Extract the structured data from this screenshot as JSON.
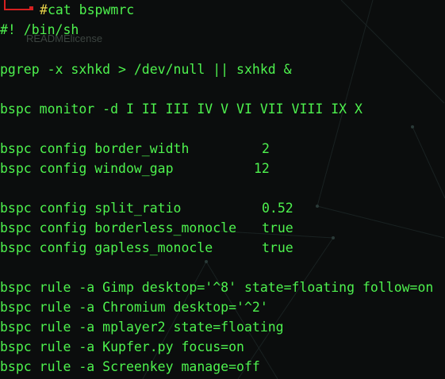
{
  "prompt": {
    "symbol": "#",
    "command": "cat bspwmrc"
  },
  "ghost_text": {
    "left": "README",
    "right": "license"
  },
  "lines": [
    "#! /bin/sh",
    "",
    "pgrep -x sxhkd > /dev/null || sxhkd &",
    "",
    "bspc monitor -d I II III IV V VI VII VIII IX X",
    "",
    "bspc config border_width",
    "bspc config window_gap",
    "",
    "bspc config split_ratio",
    "bspc config borderless_monocle",
    "bspc config gapless_monocle",
    "",
    "bspc rule -a Gimp desktop='^8' state=floating follow=on",
    "bspc rule -a Chromium desktop='^2'",
    "bspc rule -a mplayer2 state=floating",
    "bspc rule -a Kupfer.py focus=on",
    "bspc rule -a Screenkey manage=off"
  ],
  "config_values": {
    "border_width": "2",
    "window_gap": "12",
    "split_ratio": "0.52",
    "borderless_monocle": "true",
    "gapless_monocle": "true"
  },
  "colors": {
    "background": "#0b0d0d",
    "text": "#4ef24e",
    "prompt_symbol": "#e8d34a",
    "prompt_corner": "#d62020",
    "ghost_text": "#3c4440"
  }
}
